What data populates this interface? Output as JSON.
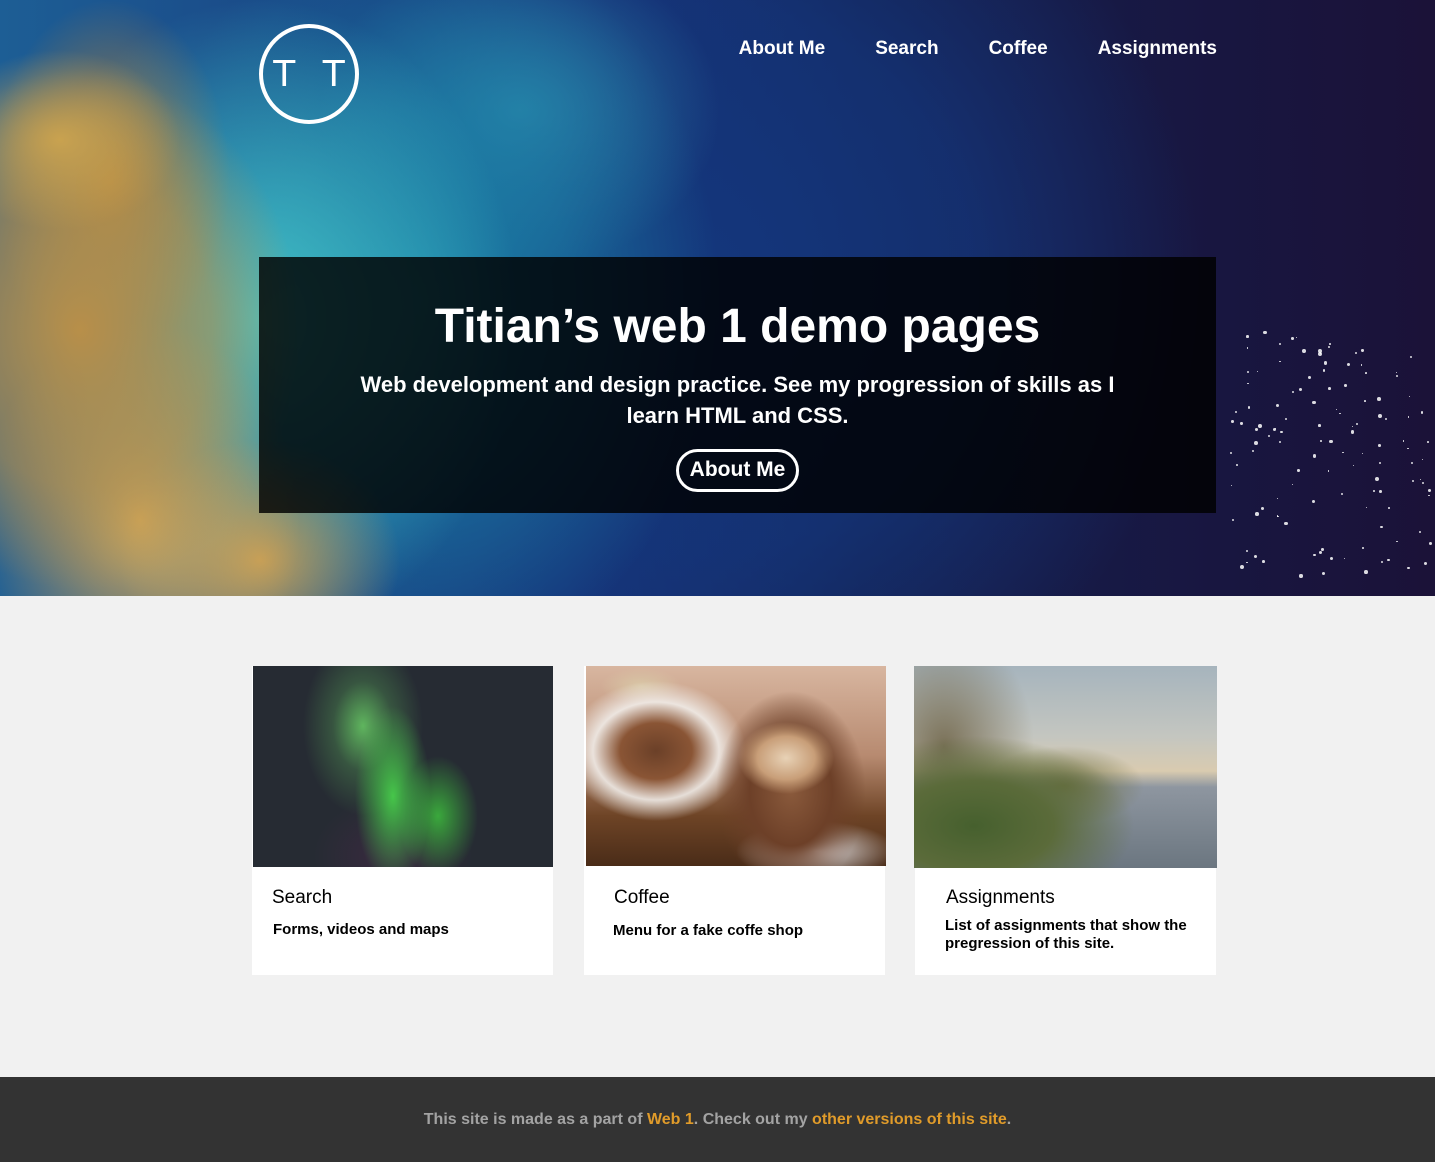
{
  "logo": {
    "text": "T T"
  },
  "nav": {
    "items": [
      {
        "label": "About Me"
      },
      {
        "label": "Search"
      },
      {
        "label": "Coffee"
      },
      {
        "label": "Assignments"
      }
    ]
  },
  "hero": {
    "title": "Titian’s web 1 demo pages",
    "subtitle": "Web development and design practice. See my progression of skills as I learn HTML and CSS.",
    "cta_label": "About Me"
  },
  "cards": [
    {
      "title": "Search",
      "description": "Forms, videos and maps"
    },
    {
      "title": "Coffee",
      "description": "Menu for a fake coffe shop"
    },
    {
      "title": "Assignments",
      "description": "List of assignments that show the pregression of this site."
    }
  ],
  "footer": {
    "text_before": "This site is made as a part of ",
    "link1": "Web 1",
    "text_middle": ". Check out my ",
    "link2": "other versions of this site",
    "text_after": "."
  },
  "colors": {
    "footer_bg": "#333333",
    "footer_text": "#a3a3a3",
    "footer_link": "#e09b2a",
    "page_bg": "#f1f1f1"
  }
}
